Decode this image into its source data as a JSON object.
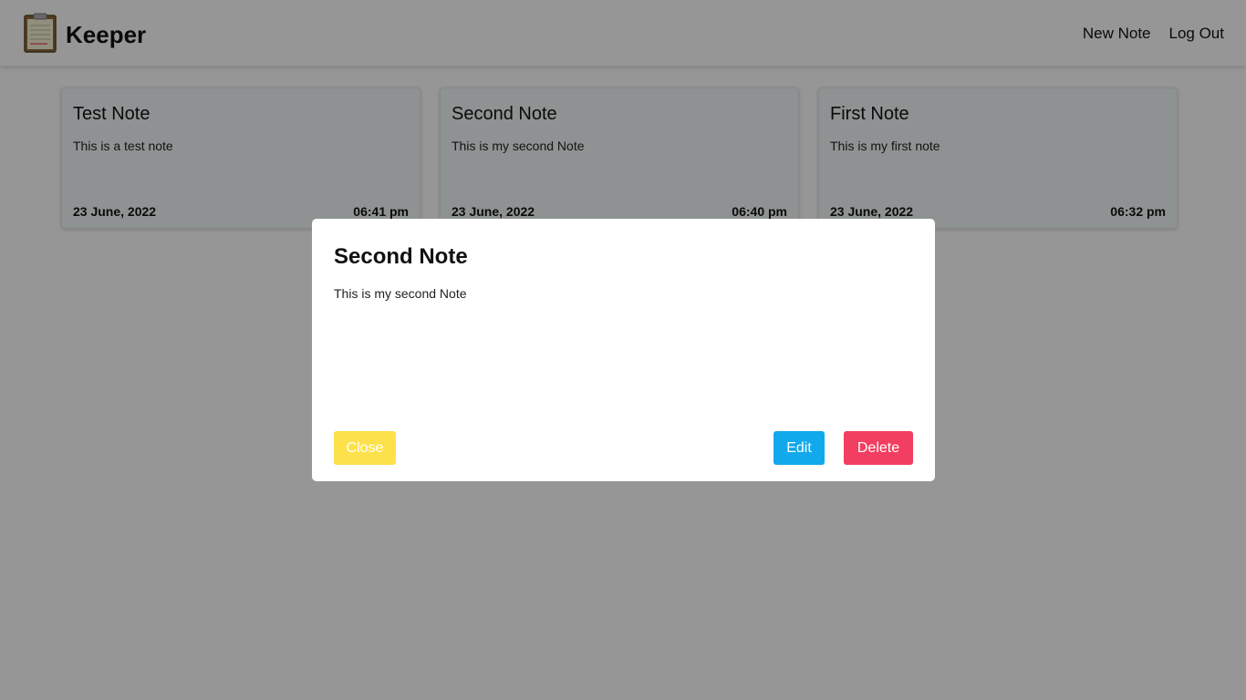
{
  "app": {
    "brand": "Keeper",
    "logo_icon": "clipboard-icon"
  },
  "nav": {
    "new_note_label": "New Note",
    "logout_label": "Log Out"
  },
  "notes": [
    {
      "title": "Test Note",
      "body": "This is a test note",
      "date": "23 June, 2022",
      "time": "06:41 pm"
    },
    {
      "title": "Second Note",
      "body": "This is my second Note",
      "date": "23 June, 2022",
      "time": "06:40 pm"
    },
    {
      "title": "First Note",
      "body": "This is my first note",
      "date": "23 June, 2022",
      "time": "06:32 pm"
    }
  ],
  "modal": {
    "title": "Second Note",
    "body": "This is my second Note",
    "close_label": "Close",
    "edit_label": "Edit",
    "delete_label": "Delete"
  },
  "colors": {
    "close": "#fce14b",
    "edit": "#11a9ec",
    "delete": "#f23e60",
    "overlay": "rgba(0,0,0,0.41)"
  }
}
